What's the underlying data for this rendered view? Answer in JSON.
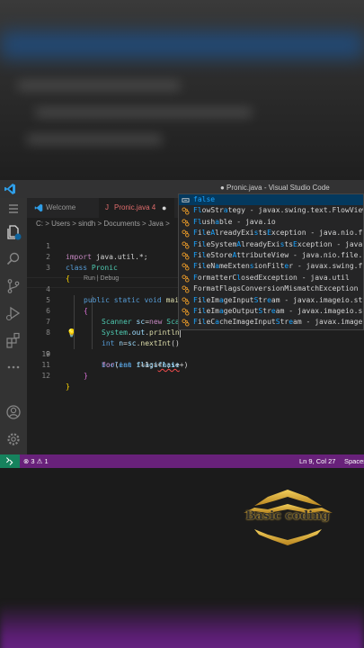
{
  "titlebar": {
    "title": "● Pronic.java - Visual Studio Code"
  },
  "tabs": [
    {
      "label": "Welcome"
    },
    {
      "label": "Pronic.java 4"
    }
  ],
  "breadcrumb": {
    "path": "C: > Users > sindh > Documents > Java >"
  },
  "codelens": "Run | Debug",
  "lines": [
    {
      "num": "1",
      "text": "import java.util.*;"
    },
    {
      "num": "2",
      "text": "class Pronic"
    },
    {
      "num": "3",
      "text": "{"
    },
    {
      "num": "4",
      "text": "public static void mai"
    },
    {
      "num": "5",
      "text": "{"
    },
    {
      "num": "6",
      "text": "Scanner sc=new Sca"
    },
    {
      "num": "7",
      "text": "System.out.println"
    },
    {
      "num": "8",
      "text": "int n=sc.nextInt()"
    },
    {
      "num": "9",
      "text": "boolean flag=flase"
    },
    {
      "num": "10",
      "text": "for(int i=1;i<n;i++)"
    },
    {
      "num": "11",
      "text": "}"
    },
    {
      "num": "12",
      "text": "}"
    }
  ],
  "suggestions": [
    {
      "icon": "keyword-icon",
      "label": "false"
    },
    {
      "icon": "class-icon",
      "label": "FlowStrategy - javax.swing.text.FlowView"
    },
    {
      "icon": "class-icon",
      "label": "Flushable - java.io"
    },
    {
      "icon": "class-icon",
      "label": "FileAlreadyExistsException - java.nio.f"
    },
    {
      "icon": "class-icon",
      "label": "FileSystemAlreadyExistsException - java"
    },
    {
      "icon": "class-icon",
      "label": "FileStoreAttributeView - java.nio.file."
    },
    {
      "icon": "class-icon",
      "label": "FileNameExtensionFilter - javax.swing.f"
    },
    {
      "icon": "class-icon",
      "label": "FormatterClosedException - java.util"
    },
    {
      "icon": "class-icon",
      "label": "FormatFlagsConversionMismatchException"
    },
    {
      "icon": "class-icon",
      "label": "FileImageInputStream - javax.imageio.st"
    },
    {
      "icon": "class-icon",
      "label": "FileImageOutputStream - javax.imageio.s"
    },
    {
      "icon": "class-icon",
      "label": "FileCacheImageInputStream - javax.image"
    }
  ],
  "statusbar": {
    "errors": "3",
    "warnings": "1",
    "position": "Ln 9, Col 27",
    "spaces": "Spaces"
  },
  "watermark": {
    "text": "Basic coding"
  },
  "colors": {
    "statusbar": "#68217a",
    "remote": "#16825d",
    "suggest_selected": "#04395e",
    "match_highlight": "#18a3ff"
  }
}
